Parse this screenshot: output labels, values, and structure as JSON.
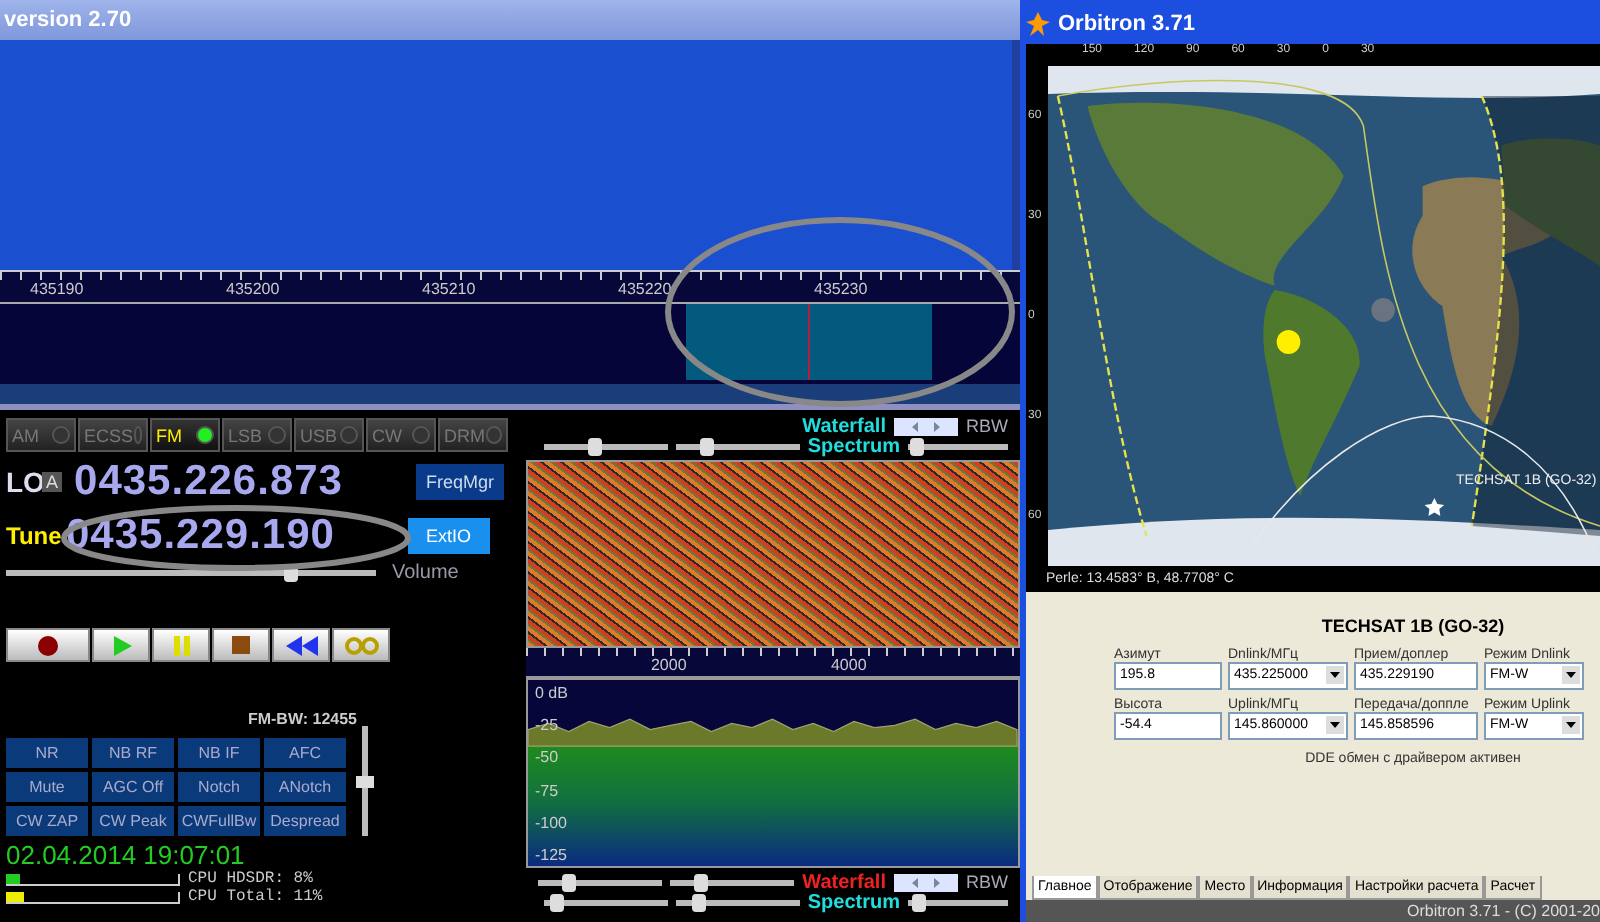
{
  "sdr": {
    "title": "version 2.70",
    "scale_labels": [
      "435190",
      "435200",
      "435210",
      "435220",
      "435230"
    ],
    "modes": [
      {
        "label": "AM",
        "selected": false
      },
      {
        "label": "ECSS",
        "selected": false
      },
      {
        "label": "FM",
        "selected": true
      },
      {
        "label": "LSB",
        "selected": false
      },
      {
        "label": "USB",
        "selected": false
      },
      {
        "label": "CW",
        "selected": false
      },
      {
        "label": "DRM",
        "selected": false
      }
    ],
    "lo": {
      "label": "LO",
      "bank": "A",
      "freq": "0435.226.873",
      "button": "FreqMgr"
    },
    "tune": {
      "label": "Tune",
      "freq": "0435.229.190",
      "button": "ExtIO"
    },
    "volume": {
      "label": "Volume",
      "level": 0.78
    },
    "bandwidth": {
      "label": "FM-BW: 12455",
      "level": 0.5
    },
    "dsp_buttons": [
      "NR",
      "NB RF",
      "NB IF",
      "AFC",
      "Mute",
      "AGC Off",
      "Notch",
      "ANotch",
      "CW ZAP",
      "CW Peak",
      "CWFullBw",
      "Despread"
    ],
    "datetime": "02.04.2014 19:07:01",
    "cpu": [
      {
        "label": "CPU HDSDR: 8%",
        "level": 0.08,
        "color": "#22cc22"
      },
      {
        "label": "CPU Total: 11%",
        "level": 0.11,
        "color": "#eeee00"
      }
    ],
    "top_rows": [
      {
        "sliders": [],
        "label": "Waterfall",
        "color": "#22dddd",
        "kind": "nav",
        "tail_label": "RBW"
      },
      {
        "sliders": [
          {
            "level": 0.4
          },
          {
            "level": 0.22
          }
        ],
        "label": "Spectrum",
        "color": "#22dddd",
        "kind": "slider",
        "level": 0.02
      }
    ],
    "waterfall_scale": [
      "2000",
      "4000"
    ],
    "db_labels": [
      "0 dB",
      "-25",
      "-50",
      "-75",
      "-100",
      "-125"
    ],
    "bottom_rows": [
      {
        "sliders": [
          {
            "level": 0.22
          },
          {
            "level": 0.22
          }
        ],
        "label": "Waterfall",
        "color": "#ee2222",
        "kind": "nav",
        "tail_label": "RBW"
      },
      {
        "sliders": [
          {
            "level": 0.05
          },
          {
            "level": 0.14
          }
        ],
        "label": "Spectrum",
        "color": "#22dddd",
        "kind": "slider",
        "level": 0.05
      }
    ]
  },
  "orbitron": {
    "title": "Orbitron 3.71",
    "lon_labels": [
      "150",
      "120",
      "90",
      "60",
      "30",
      "0",
      "30"
    ],
    "lat_labels": [
      "60",
      "30",
      "0",
      "30",
      "60"
    ],
    "satellite_label": "TECHSAT 1B (GO-32)",
    "position": "Perle: 13.4583° B, 48.7708° C",
    "panel_title": "TECHSAT 1B (GO-32)",
    "fields": [
      {
        "label": "Азимут",
        "value": "195.8",
        "kind": "text"
      },
      {
        "label": "Dnlink/МГц",
        "value": "435.225000",
        "kind": "select"
      },
      {
        "label": "Прием/доплер",
        "value": "435.229190",
        "kind": "text"
      },
      {
        "label": "Режим Dnlink",
        "value": "FM-W",
        "kind": "select"
      },
      {
        "label": "Высота",
        "value": "-54.4",
        "kind": "text"
      },
      {
        "label": "Uplink/МГц",
        "value": "145.860000",
        "kind": "select"
      },
      {
        "label": "Передача/доппле",
        "value": "145.858596",
        "kind": "text"
      },
      {
        "label": "Режим Uplink",
        "value": "FM-W",
        "kind": "select"
      }
    ],
    "status": "DDE обмен с драйвером активен",
    "tabs": [
      {
        "label": "Главное",
        "selected": true
      },
      {
        "label": "Отображение",
        "selected": false
      },
      {
        "label": "Место",
        "selected": false
      },
      {
        "label": "Информация",
        "selected": false
      },
      {
        "label": "Настройки расчета",
        "selected": false
      },
      {
        "label": "Расчет",
        "selected": false
      }
    ],
    "footer": "Orbitron 3.71 - (C) 2001-20"
  }
}
